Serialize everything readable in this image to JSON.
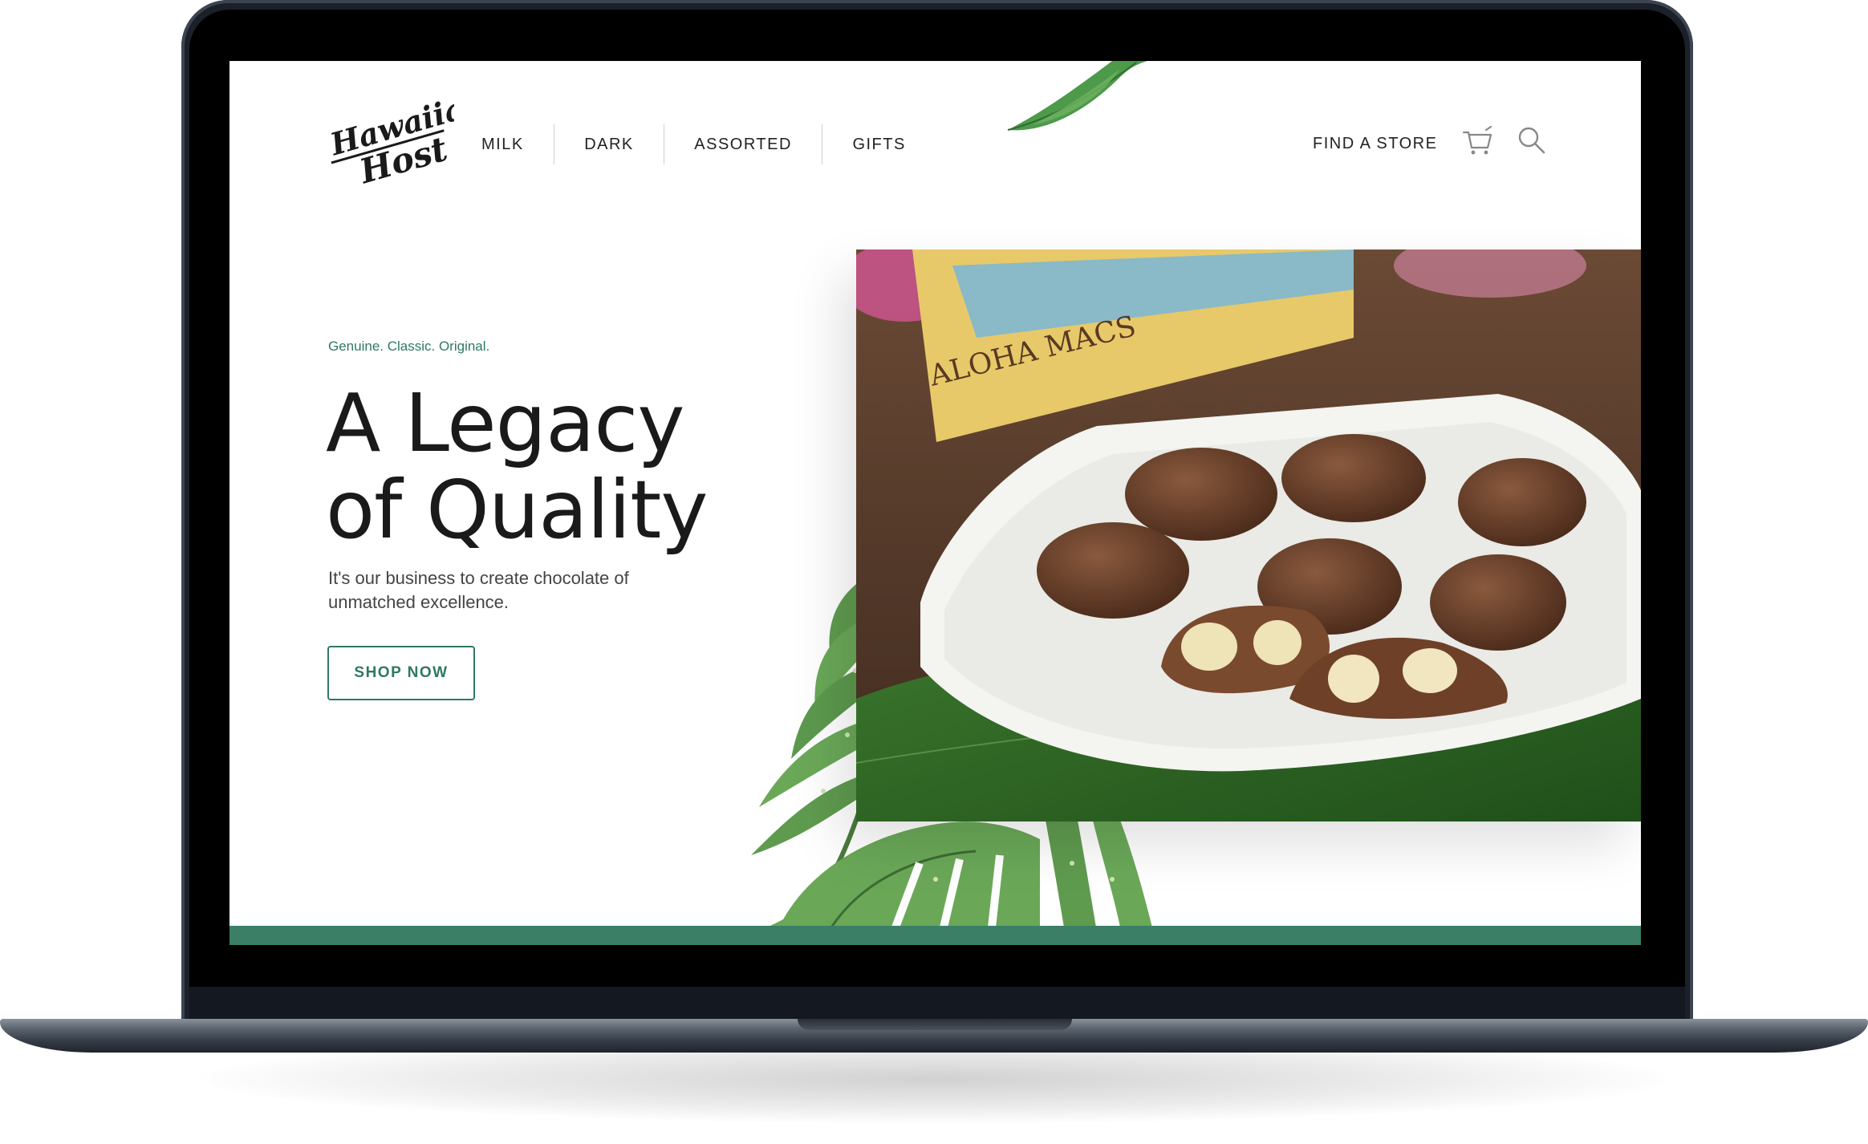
{
  "brand": {
    "logo_text_line1": "Hawaiian",
    "logo_text_line2": "Host"
  },
  "nav": {
    "items": [
      {
        "label": "MILK"
      },
      {
        "label": "DARK"
      },
      {
        "label": "ASSORTED"
      },
      {
        "label": "GIFTS"
      }
    ],
    "find_store": "FIND A STORE"
  },
  "hero": {
    "tagline": "Genuine. Classic. Original.",
    "headline": "A Legacy of Quality",
    "subtext": "It's our business to create chocolate of unmatched excellence.",
    "cta_label": "SHOP NOW",
    "package_text": "ALOHA MACS"
  },
  "icons": {
    "cart": "cart-icon",
    "search": "search-icon"
  },
  "colors": {
    "accent_green": "#2e7a5e",
    "bar_green": "#3a7f66",
    "laptop_frame": "#1b2029"
  }
}
